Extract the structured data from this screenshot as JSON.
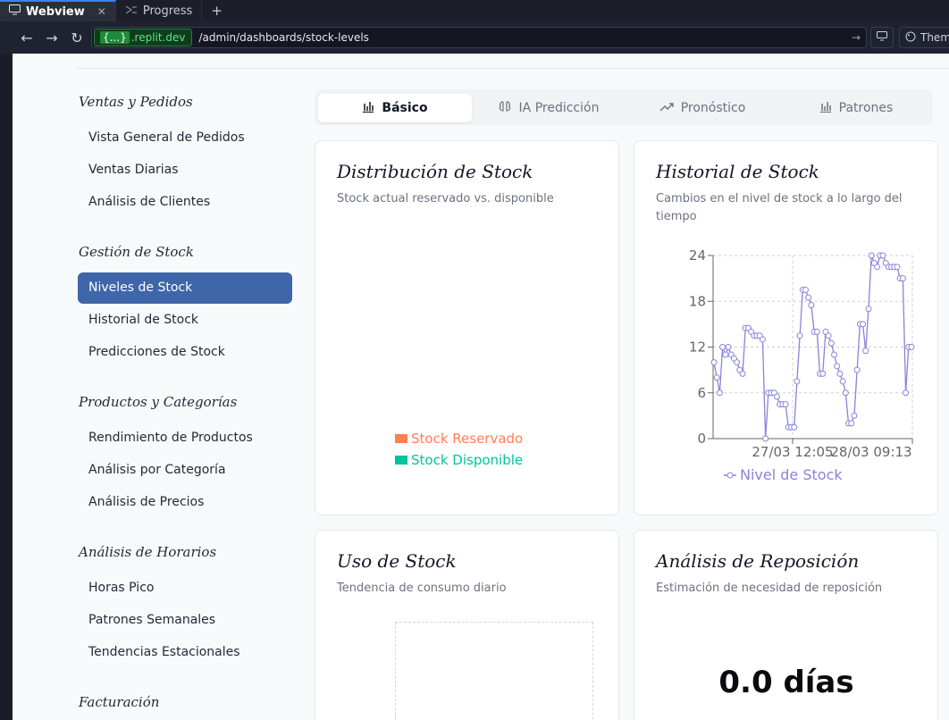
{
  "browser": {
    "tabs": [
      {
        "label": "Webview",
        "active": true
      },
      {
        "label": "Progress",
        "active": false
      }
    ],
    "url_host_braces": "{...}",
    "url_host": ".replit.dev",
    "url_path": "/admin/dashboards/stock-levels",
    "theme_label": "Them"
  },
  "sidebar": {
    "sections": [
      {
        "title": "Ventas y Pedidos",
        "items": [
          "Vista General de Pedidos",
          "Ventas Diarias",
          "Análisis de Clientes"
        ]
      },
      {
        "title": "Gestión de Stock",
        "items": [
          "Niveles de Stock",
          "Historial de Stock",
          "Predicciones de Stock"
        ]
      },
      {
        "title": "Productos y Categorías",
        "items": [
          "Rendimiento de Productos",
          "Análisis por Categoría",
          "Análisis de Precios"
        ]
      },
      {
        "title": "Análisis de Horarios",
        "items": [
          "Horas Pico",
          "Patrones Semanales",
          "Tendencias Estacionales"
        ]
      },
      {
        "title": "Facturación",
        "items": []
      }
    ],
    "active_item": "Niveles de Stock"
  },
  "view_tabs": [
    {
      "label": "Básico",
      "icon": "bar-chart-icon",
      "active": true
    },
    {
      "label": "IA Predicción",
      "icon": "brain-icon",
      "active": false
    },
    {
      "label": "Pronóstico",
      "icon": "trending-up-icon",
      "active": false
    },
    {
      "label": "Patrones",
      "icon": "bar-chart-icon",
      "active": false
    }
  ],
  "cards": {
    "distribution": {
      "title": "Distribución de Stock",
      "subtitle": "Stock actual reservado vs. disponible",
      "legend": [
        {
          "label": "Stock Reservado",
          "color": "#ff7f50"
        },
        {
          "label": "Stock Disponible",
          "color": "#00c49f"
        }
      ]
    },
    "history": {
      "title": "Historial de Stock",
      "subtitle": "Cambios en el nivel de stock a lo largo del tiempo"
    },
    "usage": {
      "title": "Uso de Stock",
      "subtitle": "Tendencia de consumo diario"
    },
    "reposition": {
      "title": "Análisis de Reposición",
      "subtitle": "Estimación de necesidad de reposición",
      "value": "0.0 días"
    }
  },
  "chart_data": {
    "type": "line",
    "title": "",
    "xlabel": "",
    "ylabel": "",
    "ylim": [
      0,
      24
    ],
    "yticks": [
      "0",
      "6",
      "12",
      "18",
      "24"
    ],
    "xticks": [
      "27/03 12:05",
      "28/03 09:13"
    ],
    "grid": true,
    "legend_position": "bottom",
    "color": "#8884d8",
    "series": [
      {
        "name": "Nivel de Stock",
        "values": [
          10,
          8,
          6,
          12,
          11,
          12,
          11,
          10.5,
          10,
          9,
          8.5,
          14.5,
          14.5,
          14,
          13.5,
          13.5,
          13.5,
          13,
          0,
          6,
          6,
          6,
          5.5,
          4.5,
          4.5,
          4.5,
          1.5,
          1.5,
          1.5,
          7.5,
          13.5,
          19.5,
          19.5,
          18.5,
          17.5,
          14,
          14,
          8.5,
          8.5,
          14,
          13.5,
          12.5,
          11,
          9.5,
          8.5,
          7.5,
          6,
          2,
          2,
          3,
          9,
          15,
          15,
          11.5,
          17,
          24,
          23,
          22.5,
          24,
          24,
          23,
          22.5,
          22.5,
          22.5,
          22.5,
          21,
          21,
          6,
          12,
          12
        ]
      }
    ]
  }
}
